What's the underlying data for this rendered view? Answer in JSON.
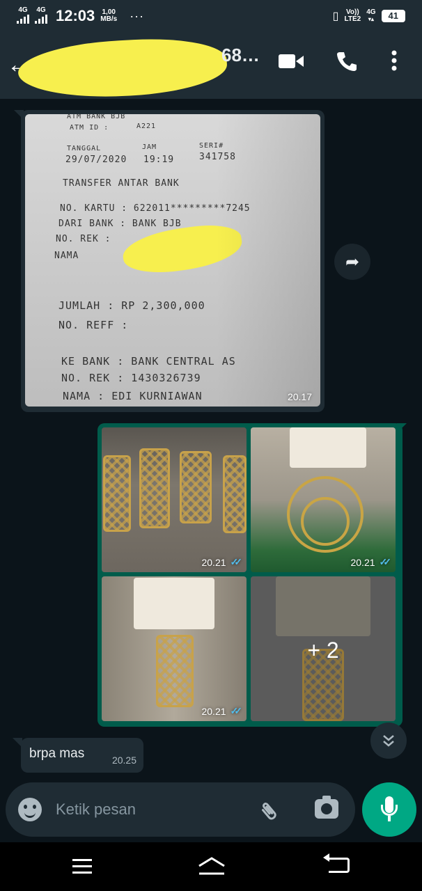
{
  "status_bar": {
    "net1": "4G",
    "net2": "4G",
    "time": "12:03",
    "speed_value": "1,00",
    "speed_unit": "MB/s",
    "dots": "···",
    "volte": "Vo))",
    "lte": "LTE2",
    "net3": "4G",
    "battery": "41"
  },
  "header": {
    "contact_name_visible": "68…",
    "icons": [
      "back-arrow-icon",
      "video-call-icon",
      "phone-icon",
      "more-vert-icon"
    ]
  },
  "messages": [
    {
      "type": "image",
      "direction": "incoming",
      "time": "20.17",
      "receipt": {
        "line1": "ATM BANK BJB",
        "atm_id_label": "ATM ID :",
        "atm_id": "A221",
        "date_label": "TANGGAL",
        "date": "29/07/2020",
        "time_label": "JAM",
        "time": "19:19",
        "seri_label": "SERI#",
        "seri": "341758",
        "title": "TRANSFER ANTAR BANK",
        "no_kartu": "NO. KARTU  : 622011*********7245",
        "dari_bank": "DARI BANK  : BANK BJB",
        "no_rek": "NO. REK    :",
        "nama": "NAMA",
        "jumlah": "JUMLAH     : RP       2,300,000",
        "no_reff": "NO. REFF   :",
        "ke_bank": "KE BANK    : BANK CENTRAL AS",
        "no_rek2": "NO. REK    : 1430326739",
        "nama2": "NAMA       : EDI KURNIAWAN"
      }
    },
    {
      "type": "image_group",
      "direction": "outgoing",
      "tiles": [
        {
          "time": "20.21",
          "status": "read"
        },
        {
          "time": "20.21",
          "status": "read"
        },
        {
          "time": "20.21",
          "status": "read"
        },
        {
          "more": "+ 2"
        }
      ]
    },
    {
      "type": "text",
      "direction": "incoming",
      "text": "brpa mas",
      "time": "20.25"
    }
  ],
  "composer": {
    "placeholder": "Ketik pesan"
  },
  "colors": {
    "header_bg": "#1f2c34",
    "chat_bg": "#0b141a",
    "outgoing_bubble": "#005c4b",
    "incoming_bubble": "#1f2c34",
    "accent": "#00a884",
    "read_ticks": "#53bdeb",
    "redaction": "#f7ef4e"
  }
}
